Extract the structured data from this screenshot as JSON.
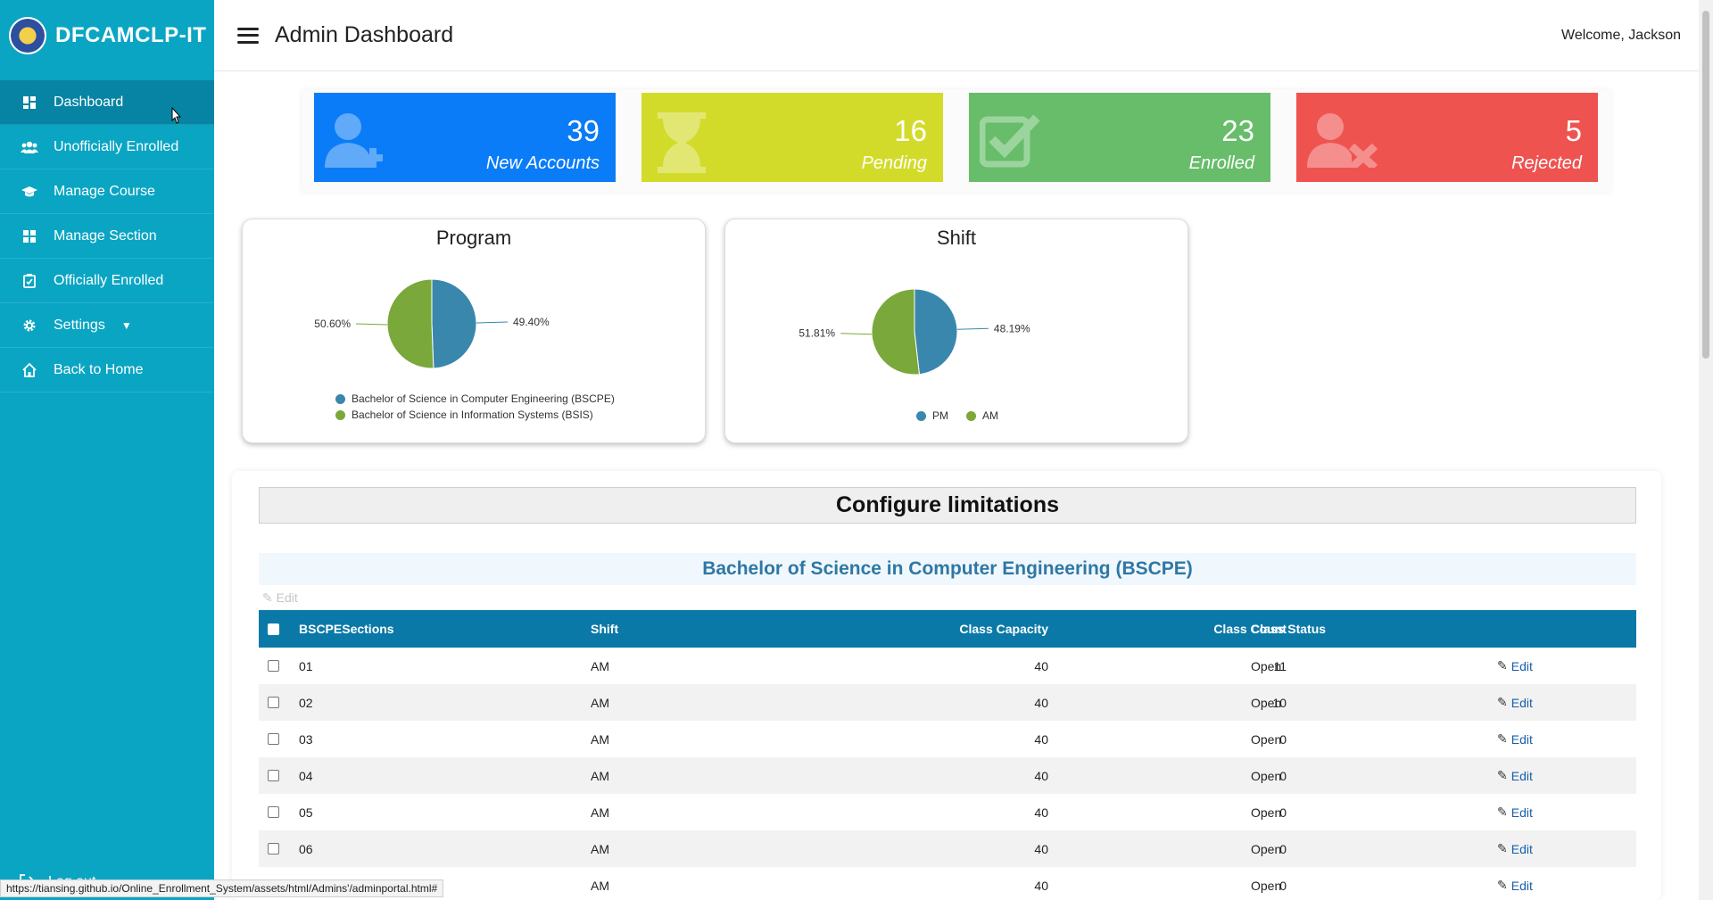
{
  "brand": {
    "name": "DFCAMCLP-IT"
  },
  "sidebar": {
    "items": [
      {
        "label": "Dashboard",
        "icon": "dashboard-icon"
      },
      {
        "label": "Unofficially Enrolled",
        "icon": "users-icon"
      },
      {
        "label": "Manage Course",
        "icon": "graduation-cap-icon"
      },
      {
        "label": "Manage Section",
        "icon": "grid-icon"
      },
      {
        "label": "Officially Enrolled",
        "icon": "clipboard-check-icon"
      },
      {
        "label": "Settings",
        "icon": "gear-icon"
      },
      {
        "label": "Back to Home",
        "icon": "home-icon"
      }
    ],
    "logout": "Log out"
  },
  "topbar": {
    "title": "Admin Dashboard",
    "welcome": "Welcome, Jackson"
  },
  "cards": [
    {
      "value": "39",
      "label": "New Accounts",
      "color": "#0a7cf7",
      "icon": "user-plus-icon"
    },
    {
      "value": "16",
      "label": "Pending",
      "color": "#d3db2a",
      "icon": "hourglass-icon"
    },
    {
      "value": "23",
      "label": "Enrolled",
      "color": "#67bd6a",
      "icon": "check-square-icon"
    },
    {
      "value": "5",
      "label": "Rejected",
      "color": "#ef5350",
      "icon": "user-times-icon"
    }
  ],
  "chart_data": [
    {
      "type": "pie",
      "title": "Program",
      "series": [
        {
          "name": "Bachelor of Science in Computer Engineering (BSCPE)",
          "value": 49.4,
          "label": "49.40%",
          "color": "#3a87ad"
        },
        {
          "name": "Bachelor of Science in Information Systems (BSIS)",
          "value": 50.6,
          "label": "50.60%",
          "color": "#7aa83a"
        }
      ]
    },
    {
      "type": "pie",
      "title": "Shift",
      "series": [
        {
          "name": "PM",
          "value": 48.19,
          "label": "48.19%",
          "color": "#3a87ad"
        },
        {
          "name": "AM",
          "value": 51.81,
          "label": "51.81%",
          "color": "#7aa83a"
        }
      ]
    }
  ],
  "config": {
    "title": "Configure limitations",
    "program": "Bachelor of Science in Computer Engineering (BSCPE)",
    "edit_label": "Edit",
    "columns": [
      "BSCPESections",
      "Shift",
      "Class Capacity",
      "Class Count",
      "Class Status"
    ],
    "rows": [
      {
        "section": "01",
        "shift": "AM",
        "capacity": "40",
        "count": "11",
        "status": "Open",
        "action": "Edit"
      },
      {
        "section": "02",
        "shift": "AM",
        "capacity": "40",
        "count": "10",
        "status": "Open",
        "action": "Edit"
      },
      {
        "section": "03",
        "shift": "AM",
        "capacity": "40",
        "count": "0",
        "status": "Open",
        "action": "Edit"
      },
      {
        "section": "04",
        "shift": "AM",
        "capacity": "40",
        "count": "0",
        "status": "Open",
        "action": "Edit"
      },
      {
        "section": "05",
        "shift": "AM",
        "capacity": "40",
        "count": "0",
        "status": "Open",
        "action": "Edit"
      },
      {
        "section": "06",
        "shift": "AM",
        "capacity": "40",
        "count": "0",
        "status": "Open",
        "action": "Edit"
      },
      {
        "section": "",
        "shift": "AM",
        "capacity": "40",
        "count": "0",
        "status": "Open",
        "action": "Edit"
      }
    ]
  },
  "statusbar": {
    "url": "https://tiansing.github.io/Online_Enrollment_System/assets/html/Admins'/adminportal.html#"
  }
}
